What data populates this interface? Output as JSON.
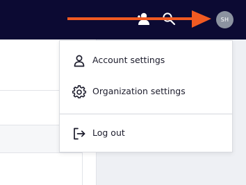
{
  "header": {
    "avatar_initials": "SH",
    "icons": [
      "user-add-icon",
      "search-icon"
    ],
    "background_color": "#0c0a33"
  },
  "account_menu": {
    "items": [
      {
        "label": "Account settings",
        "icon": "person-icon"
      },
      {
        "label": "Organization settings",
        "icon": "gear-icon"
      }
    ],
    "logout": {
      "label": "Log out",
      "icon": "logout-icon"
    }
  },
  "colors": {
    "annotation_arrow": "#f15a22",
    "avatar": "#8c93a0"
  }
}
